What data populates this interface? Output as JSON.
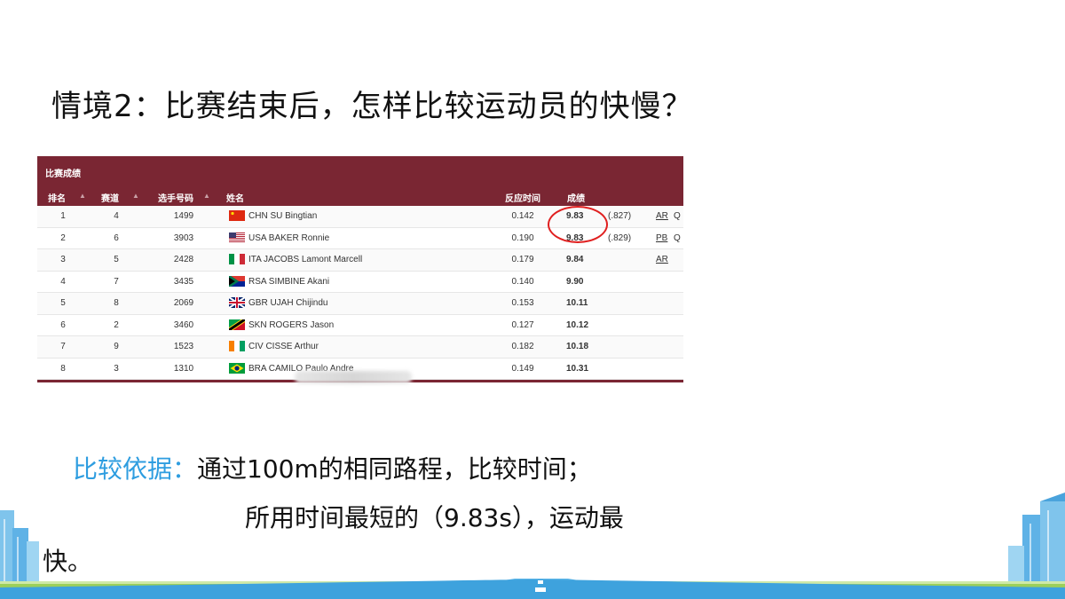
{
  "slide": {
    "title": "情境2：比赛结束后，怎样比较运动员的快慢？"
  },
  "results_table": {
    "caption": "比赛成绩",
    "columns": {
      "rank": "排名",
      "lane": "赛道",
      "bib": "选手号码",
      "name": "姓名",
      "reaction": "反应时间",
      "result": "成绩"
    },
    "rows": [
      {
        "rank": "1",
        "lane": "4",
        "bib": "1499",
        "flag": "CHN",
        "name": "CHN SU Bingtian",
        "reaction": "0.142",
        "result": "9.83",
        "diff": "(.827)",
        "record": "AR",
        "q": "Q"
      },
      {
        "rank": "2",
        "lane": "6",
        "bib": "3903",
        "flag": "USA",
        "name": "USA BAKER Ronnie",
        "reaction": "0.190",
        "result": "9.83",
        "diff": "(.829)",
        "record": "PB",
        "q": "Q"
      },
      {
        "rank": "3",
        "lane": "5",
        "bib": "2428",
        "flag": "ITA",
        "name": "ITA JACOBS Lamont Marcell",
        "reaction": "0.179",
        "result": "9.84",
        "diff": "",
        "record": "AR",
        "q": ""
      },
      {
        "rank": "4",
        "lane": "7",
        "bib": "3435",
        "flag": "RSA",
        "name": "RSA SIMBINE Akani",
        "reaction": "0.140",
        "result": "9.90",
        "diff": "",
        "record": "",
        "q": ""
      },
      {
        "rank": "5",
        "lane": "8",
        "bib": "2069",
        "flag": "GBR",
        "name": "GBR UJAH Chijindu",
        "reaction": "0.153",
        "result": "10.11",
        "diff": "",
        "record": "",
        "q": ""
      },
      {
        "rank": "6",
        "lane": "2",
        "bib": "3460",
        "flag": "SKN",
        "name": "SKN ROGERS Jason",
        "reaction": "0.127",
        "result": "10.12",
        "diff": "",
        "record": "",
        "q": ""
      },
      {
        "rank": "7",
        "lane": "9",
        "bib": "1523",
        "flag": "CIV",
        "name": "CIV CISSE Arthur",
        "reaction": "0.182",
        "result": "10.18",
        "diff": "",
        "record": "",
        "q": ""
      },
      {
        "rank": "8",
        "lane": "3",
        "bib": "1310",
        "flag": "BRA",
        "name": "BRA CAMILO Paulo Andre",
        "reaction": "0.149",
        "result": "10.31",
        "diff": "",
        "record": "",
        "q": ""
      }
    ],
    "header_color": "#7a2633",
    "highlight_color": "#e02020"
  },
  "basis": {
    "label": "比较依据：",
    "text": "通过100m的相同路程，比较时间；",
    "conclusion": "所用时间最短的（9.83s），运动最",
    "conclusion_tail": "快。",
    "label_color": "#2e9de0"
  }
}
